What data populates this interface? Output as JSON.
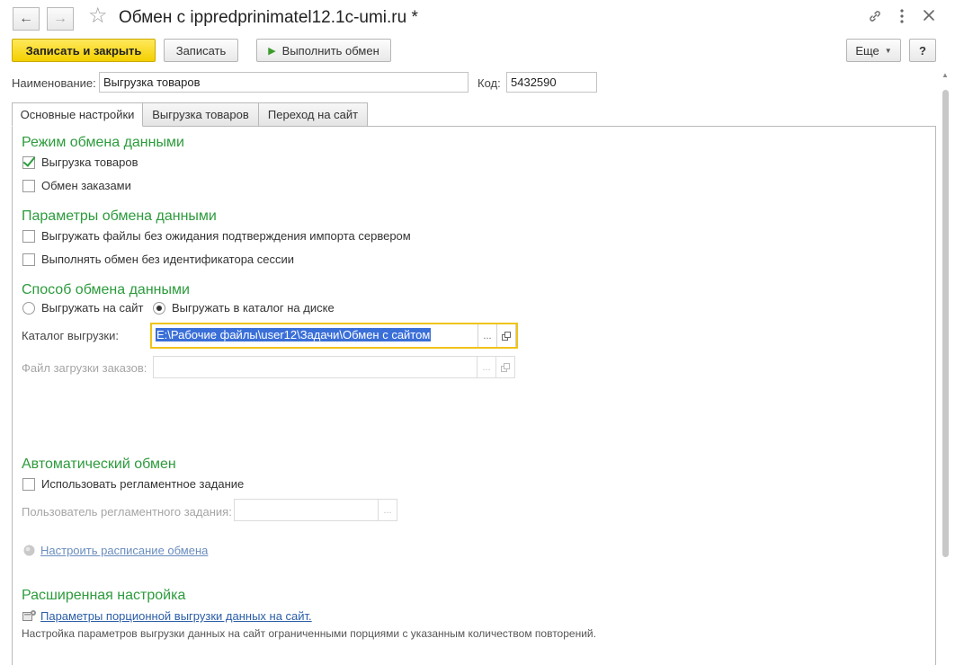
{
  "window": {
    "title": "Обмен с ippredprinimatel12.1c-umi.ru *"
  },
  "toolbar": {
    "save_close": "Записать и закрыть",
    "save": "Записать",
    "run_exchange": "Выполнить обмен",
    "more": "Еще",
    "help": "?"
  },
  "form": {
    "name_label": "Наименование:",
    "name_value": "Выгрузка товаров",
    "code_label": "Код:",
    "code_value": "5432590"
  },
  "tabs": [
    {
      "label": "Основные настройки",
      "active": true
    },
    {
      "label": "Выгрузка товаров",
      "active": false
    },
    {
      "label": "Переход на сайт",
      "active": false
    }
  ],
  "sections": {
    "mode": {
      "title": "Режим обмена данными",
      "items": [
        {
          "label": "Выгрузка товаров",
          "checked": true
        },
        {
          "label": "Обмен заказами",
          "checked": false
        }
      ]
    },
    "params": {
      "title": "Параметры обмена данными",
      "items": [
        {
          "label": "Выгружать файлы без ожидания подтверждения импорта сервером",
          "checked": false
        },
        {
          "label": "Выполнять обмен без идентификатора сессии",
          "checked": false
        }
      ]
    },
    "method": {
      "title": "Способ обмена данными",
      "options": [
        {
          "label": "Выгружать на сайт",
          "selected": false
        },
        {
          "label": "Выгружать в каталог на диске",
          "selected": true
        }
      ],
      "catalog_label": "Каталог выгрузки:",
      "catalog_value": "E:\\Рабочие файлы\\user12\\Задачи\\Обмен с сайтом",
      "orders_label": "Файл загрузки заказов:",
      "orders_value": ""
    },
    "auto": {
      "title": "Автоматический обмен",
      "use_scheduled": "Использовать регламентное задание",
      "user_label": "Пользователь регламентного задания:",
      "user_value": "",
      "schedule_link": "Настроить расписание обмена"
    },
    "advanced": {
      "title": "Расширенная настройка",
      "batch_link": "Параметры порционной выгрузки данных на сайт.",
      "note": "Настройка параметров выгрузки данных на сайт ограниченными порциями с указанным количеством повторений."
    }
  },
  "icons": {
    "back": "arrow-left-icon",
    "forward": "arrow-right-icon",
    "favorite": "star-icon",
    "link": "link-icon",
    "menu": "kebab-menu-icon",
    "close": "close-icon",
    "play": "play-icon",
    "select": "ellipsis-icon",
    "open": "open-window-icon",
    "schedule": "schedule-icon",
    "settings": "settings-icon"
  },
  "colors": {
    "primary_button": "#f4cf00",
    "section_title": "#2c9b3c",
    "link": "#2b5ea7",
    "focus_border": "#f0c419",
    "selection": "#3a6fd8"
  }
}
